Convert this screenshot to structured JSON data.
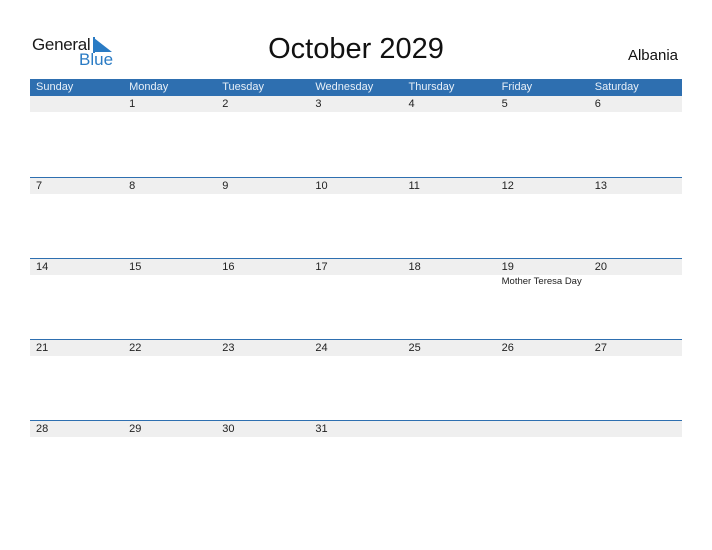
{
  "logo": {
    "text_general": "General",
    "text_blue": "Blue",
    "accent": "#2a7bc4"
  },
  "title": "October 2029",
  "country": "Albania",
  "colors": {
    "header_bg": "#2e6fb0",
    "date_band_bg": "#efefef"
  },
  "weekdays": [
    "Sunday",
    "Monday",
    "Tuesday",
    "Wednesday",
    "Thursday",
    "Friday",
    "Saturday"
  ],
  "weeks": [
    {
      "days": [
        "",
        "1",
        "2",
        "3",
        "4",
        "5",
        "6"
      ],
      "events": [
        "",
        "",
        "",
        "",
        "",
        "",
        ""
      ]
    },
    {
      "days": [
        "7",
        "8",
        "9",
        "10",
        "11",
        "12",
        "13"
      ],
      "events": [
        "",
        "",
        "",
        "",
        "",
        "",
        ""
      ]
    },
    {
      "days": [
        "14",
        "15",
        "16",
        "17",
        "18",
        "19",
        "20"
      ],
      "events": [
        "",
        "",
        "",
        "",
        "",
        "Mother Teresa Day",
        ""
      ]
    },
    {
      "days": [
        "21",
        "22",
        "23",
        "24",
        "25",
        "26",
        "27"
      ],
      "events": [
        "",
        "",
        "",
        "",
        "",
        "",
        ""
      ]
    },
    {
      "days": [
        "28",
        "29",
        "30",
        "31",
        "",
        "",
        ""
      ],
      "events": [
        "",
        "",
        "",
        "",
        "",
        "",
        ""
      ]
    }
  ]
}
